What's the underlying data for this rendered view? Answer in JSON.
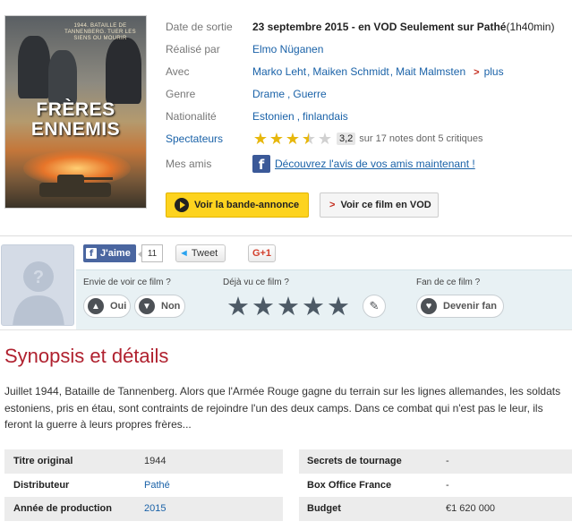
{
  "poster": {
    "tagline": "1944. BATAILLE DE TANNENBERG. TUER LES SIENS OU MOURIR",
    "title_line1": "FRÈRES",
    "title_line2": "ENNEMIS"
  },
  "info": {
    "release": {
      "label": "Date de sortie",
      "value": "23 septembre 2015 - en VOD Seulement sur Pathé",
      "duration": " (1h40min)"
    },
    "director": {
      "label": "Réalisé par",
      "value": "Elmo Nüganen"
    },
    "cast": {
      "label": "Avec",
      "actors": [
        "Marko Leht",
        "Maiken Schmidt",
        "Mait Malmsten"
      ],
      "more": "plus"
    },
    "genre": {
      "label": "Genre",
      "values": [
        "Drame",
        "Guerre"
      ]
    },
    "nationality": {
      "label": "Nationalité",
      "values": [
        "Estonien",
        "finlandais"
      ]
    },
    "spectators": {
      "label": "Spectateurs",
      "score": "3,2",
      "score_value": 3.2,
      "score_max": 5,
      "summary": "sur 17 notes dont 5 critiques"
    },
    "friends": {
      "label": "Mes amis",
      "link": "Découvrez l'avis de vos amis maintenant !"
    }
  },
  "buttons": {
    "trailer": "Voir la bande-annonce",
    "vod": "Voir ce film en VOD"
  },
  "social": {
    "like_label": "J'aime",
    "like_count": "11",
    "tweet_label": "Tweet",
    "gplus_label": "G+1"
  },
  "user": {
    "want_title": "Envie de voir ce film ?",
    "yes": "Oui",
    "no": "Non",
    "seen_title": "Déjà vu ce film ?",
    "fan_title": "Fan de ce film ?",
    "fan_button": "Devenir fan"
  },
  "synopsis": {
    "title": "Synopsis et détails",
    "text": "Juillet 1944, Bataille de Tannenberg. Alors que l'Armée Rouge gagne du terrain sur les lignes allemandes, les soldats estoniens, pris en étau, sont contraints de rejoindre l'un des deux camps. Dans ce combat qui n'est pas le leur, ils feront la guerre à leurs propres frères..."
  },
  "details_left": [
    {
      "key": "Titre original",
      "value": "1944",
      "link": false
    },
    {
      "key": "Distributeur",
      "value": "Pathé",
      "link": true
    },
    {
      "key": "Année de production",
      "value": "2015",
      "link": true
    }
  ],
  "details_right": [
    {
      "key": "Secrets de tournage",
      "value": "-",
      "link": false
    },
    {
      "key": "Box Office France",
      "value": "-",
      "link": false
    },
    {
      "key": "Budget",
      "value": "€1 620 000",
      "link": false
    }
  ],
  "icons": {
    "play": "play-circle-icon",
    "chevron": "chevron-right-icon",
    "facebook": "facebook-icon",
    "thumbs_up": "thumbs-up-icon",
    "thumbs_down": "thumbs-down-icon",
    "heart": "heart-icon",
    "pencil": "pencil-icon"
  },
  "colors": {
    "accent_red": "#b0212f",
    "link_blue": "#1a62a8",
    "trailer_yellow": "#fdd31f",
    "star_gold": "#e7b70c"
  }
}
